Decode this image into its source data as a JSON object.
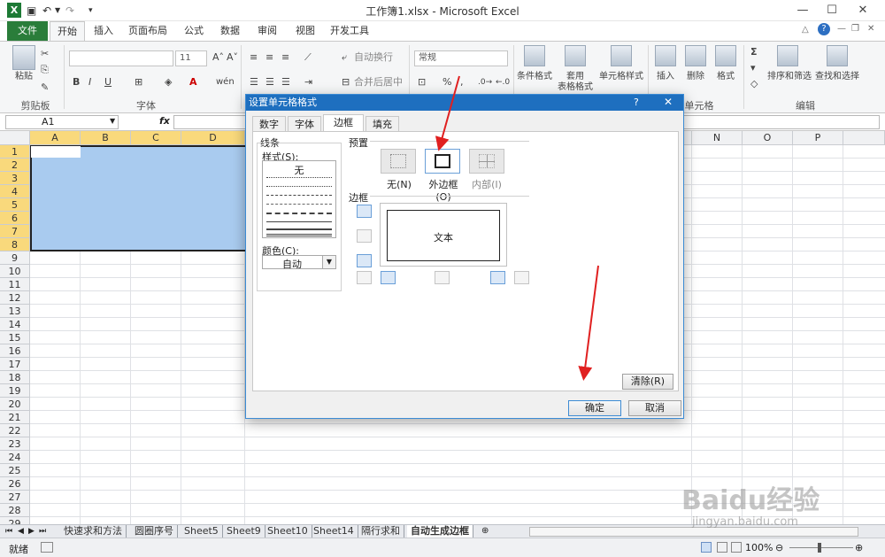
{
  "window": {
    "title": "工作簿1.xlsx - Microsoft Excel",
    "minimize": "—",
    "maximize": "☐",
    "close": "✕"
  },
  "quickaccess": {
    "undo": "↶",
    "redo": "↷"
  },
  "ribbon_tabs": [
    "文件",
    "开始",
    "插入",
    "页面布局",
    "公式",
    "数据",
    "审阅",
    "视图",
    "开发工具"
  ],
  "ribbon": {
    "paste": "粘贴",
    "clipboard_group": "剪贴板",
    "font_group": "字体",
    "font_size": "11",
    "bold": "B",
    "italic": "I",
    "underline": "U",
    "wrap_text": "自动换行",
    "merge_center": "合并后居中",
    "number_format": "常规",
    "percent": "%",
    "comma": ",",
    "conditional_format": "条件格式",
    "table_format_1": "套用",
    "table_format_2": "表格格式",
    "cell_style": "单元格样式",
    "insert": "插入",
    "delete": "删除",
    "format": "格式",
    "cells_group": "单元格",
    "sort_filter": "排序和筛选",
    "find_select": "查找和选择",
    "editing_group": "编辑",
    "sigma": "Σ"
  },
  "formula_bar": {
    "name_box": "A1",
    "fx": "fx"
  },
  "columns": [
    "A",
    "B",
    "C",
    "D",
    "N",
    "O",
    "P"
  ],
  "rows": [
    "1",
    "2",
    "3",
    "4",
    "5",
    "6",
    "7",
    "8",
    "9",
    "10",
    "11",
    "12",
    "13",
    "14",
    "15",
    "16",
    "17",
    "18",
    "19",
    "20",
    "21",
    "22",
    "23",
    "24",
    "25",
    "26",
    "27",
    "28",
    "29",
    "30"
  ],
  "sheet_tabs": [
    "快速求和方法",
    "圆圈序号",
    "Sheet5",
    "Sheet9",
    "Sheet10",
    "Sheet14",
    "隔行求和",
    "自动生成边框"
  ],
  "status": {
    "ready": "就绪",
    "zoom": "100%"
  },
  "dialog": {
    "title": "设置单元格格式",
    "help": "?",
    "close": "✕",
    "tabs": [
      "数字",
      "字体",
      "边框",
      "填充"
    ],
    "line_group": "线条",
    "style_label": "样式(S):",
    "style_none": "无",
    "color_label": "颜色(C):",
    "color_value": "自动",
    "preset_group": "预置",
    "presets": [
      "无(N)",
      "外边框(O)",
      "内部(I)"
    ],
    "border_group": "边框",
    "preview_text": "文本",
    "clear_button": "清除(R)",
    "ok": "确定",
    "cancel": "取消"
  },
  "watermark": {
    "brand": "Baidu经验",
    "url": "jingyan.baidu.com"
  },
  "colors": {
    "selection": "#a9cbef",
    "file_tab": "#2a7d3a",
    "dialog_title": "#1e6fbf",
    "arrow": "#e02020"
  }
}
